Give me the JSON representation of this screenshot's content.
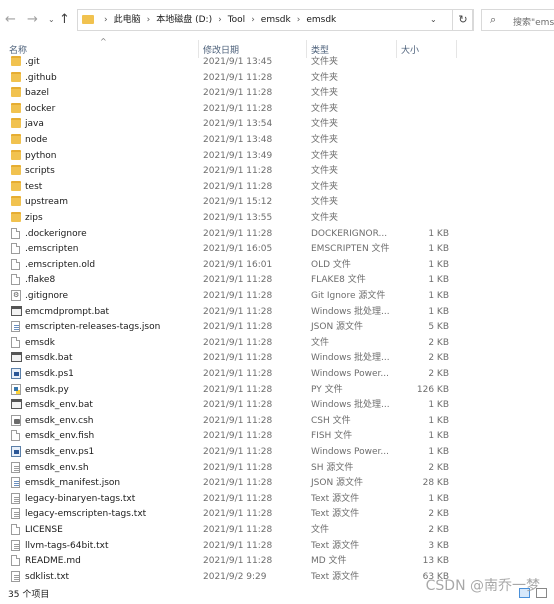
{
  "nav": {
    "back_glyph": "←",
    "forward_glyph": "→",
    "recent_glyph": "⌄",
    "up_glyph": "↑",
    "breadcrumb": [
      "此电脑",
      "本地磁盘 (D:)",
      "Tool",
      "emsdk",
      "emsdk"
    ],
    "crumb_sep": "›",
    "dropdown_glyph": "⌄",
    "refresh_glyph": "↻",
    "search_placeholder": "搜索\"emsdk"
  },
  "columns": {
    "name": "名称",
    "date": "修改日期",
    "type": "类型",
    "size": "大小",
    "sort_glyph": "^"
  },
  "files": [
    {
      "name": ".git",
      "date": "2021/9/1 13:45",
      "type": "文件夹",
      "size": "",
      "icon": "folder-icon"
    },
    {
      "name": ".github",
      "date": "2021/9/1 11:28",
      "type": "文件夹",
      "size": "",
      "icon": "folder-icon"
    },
    {
      "name": "bazel",
      "date": "2021/9/1 11:28",
      "type": "文件夹",
      "size": "",
      "icon": "folder-icon"
    },
    {
      "name": "docker",
      "date": "2021/9/1 11:28",
      "type": "文件夹",
      "size": "",
      "icon": "folder-icon"
    },
    {
      "name": "java",
      "date": "2021/9/1 13:54",
      "type": "文件夹",
      "size": "",
      "icon": "folder-icon"
    },
    {
      "name": "node",
      "date": "2021/9/1 13:48",
      "type": "文件夹",
      "size": "",
      "icon": "folder-icon"
    },
    {
      "name": "python",
      "date": "2021/9/1 13:49",
      "type": "文件夹",
      "size": "",
      "icon": "folder-icon"
    },
    {
      "name": "scripts",
      "date": "2021/9/1 11:28",
      "type": "文件夹",
      "size": "",
      "icon": "folder-icon"
    },
    {
      "name": "test",
      "date": "2021/9/1 11:28",
      "type": "文件夹",
      "size": "",
      "icon": "folder-icon"
    },
    {
      "name": "upstream",
      "date": "2021/9/1 15:12",
      "type": "文件夹",
      "size": "",
      "icon": "folder-icon"
    },
    {
      "name": "zips",
      "date": "2021/9/1 13:55",
      "type": "文件夹",
      "size": "",
      "icon": "folder-icon"
    },
    {
      "name": ".dockerignore",
      "date": "2021/9/1 11:28",
      "type": "DOCKERIGNOR...",
      "size": "1 KB",
      "icon": "file-icon"
    },
    {
      "name": ".emscripten",
      "date": "2021/9/1 16:05",
      "type": "EMSCRIPTEN 文件",
      "size": "1 KB",
      "icon": "file-icon"
    },
    {
      "name": ".emscripten.old",
      "date": "2021/9/1 16:01",
      "type": "OLD 文件",
      "size": "1 KB",
      "icon": "file-icon"
    },
    {
      "name": ".flake8",
      "date": "2021/9/1 11:28",
      "type": "FLAKE8 文件",
      "size": "1 KB",
      "icon": "file-icon"
    },
    {
      "name": ".gitignore",
      "date": "2021/9/1 11:28",
      "type": "Git Ignore 源文件",
      "size": "1 KB",
      "icon": "gear-file-icon"
    },
    {
      "name": "emcmdprompt.bat",
      "date": "2021/9/1 11:28",
      "type": "Windows 批处理...",
      "size": "1 KB",
      "icon": "bat-icon"
    },
    {
      "name": "emscripten-releases-tags.json",
      "date": "2021/9/1 11:28",
      "type": "JSON 源文件",
      "size": "5 KB",
      "icon": "json-icon"
    },
    {
      "name": "emsdk",
      "date": "2021/9/1 11:28",
      "type": "文件",
      "size": "2 KB",
      "icon": "file-icon"
    },
    {
      "name": "emsdk.bat",
      "date": "2021/9/1 11:28",
      "type": "Windows 批处理...",
      "size": "2 KB",
      "icon": "bat-icon"
    },
    {
      "name": "emsdk.ps1",
      "date": "2021/9/1 11:28",
      "type": "Windows Power...",
      "size": "2 KB",
      "icon": "ps-icon"
    },
    {
      "name": "emsdk.py",
      "date": "2021/9/1 11:28",
      "type": "PY 文件",
      "size": "126 KB",
      "icon": "py-icon"
    },
    {
      "name": "emsdk_env.bat",
      "date": "2021/9/1 11:28",
      "type": "Windows 批处理...",
      "size": "1 KB",
      "icon": "bat-icon"
    },
    {
      "name": "emsdk_env.csh",
      "date": "2021/9/1 11:28",
      "type": "CSH 文件",
      "size": "1 KB",
      "icon": "csh-icon"
    },
    {
      "name": "emsdk_env.fish",
      "date": "2021/9/1 11:28",
      "type": "FISH 文件",
      "size": "1 KB",
      "icon": "file-icon"
    },
    {
      "name": "emsdk_env.ps1",
      "date": "2021/9/1 11:28",
      "type": "Windows Power...",
      "size": "1 KB",
      "icon": "ps-icon"
    },
    {
      "name": "emsdk_env.sh",
      "date": "2021/9/1 11:28",
      "type": "SH 源文件",
      "size": "2 KB",
      "icon": "txt-icon"
    },
    {
      "name": "emsdk_manifest.json",
      "date": "2021/9/1 11:28",
      "type": "JSON 源文件",
      "size": "28 KB",
      "icon": "json-icon"
    },
    {
      "name": "legacy-binaryen-tags.txt",
      "date": "2021/9/1 11:28",
      "type": "Text 源文件",
      "size": "1 KB",
      "icon": "txt-icon"
    },
    {
      "name": "legacy-emscripten-tags.txt",
      "date": "2021/9/1 11:28",
      "type": "Text 源文件",
      "size": "2 KB",
      "icon": "txt-icon"
    },
    {
      "name": "LICENSE",
      "date": "2021/9/1 11:28",
      "type": "文件",
      "size": "2 KB",
      "icon": "file-icon"
    },
    {
      "name": "llvm-tags-64bit.txt",
      "date": "2021/9/1 11:28",
      "type": "Text 源文件",
      "size": "3 KB",
      "icon": "txt-icon"
    },
    {
      "name": "README.md",
      "date": "2021/9/1 11:28",
      "type": "MD 文件",
      "size": "13 KB",
      "icon": "file-icon"
    },
    {
      "name": "sdklist.txt",
      "date": "2021/9/2 9:29",
      "type": "Text 源文件",
      "size": "63 KB",
      "icon": "txt-icon"
    }
  ],
  "status": {
    "item_count": "35 个项目"
  },
  "watermark": "CSDN @南乔一梦"
}
